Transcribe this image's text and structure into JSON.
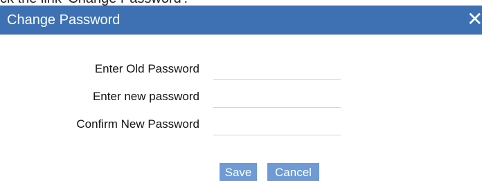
{
  "background_text": "ck the link 'Change Password'.",
  "dialog": {
    "title": "Change Password",
    "close_label": "✕",
    "header_color": "#3d71b3",
    "button_color": "#6e9ad6"
  },
  "form": {
    "fields": [
      {
        "label": "Enter Old Password",
        "value": "",
        "placeholder": ""
      },
      {
        "label": "Enter new password",
        "value": "",
        "placeholder": ""
      },
      {
        "label": "Confirm New Password",
        "value": "",
        "placeholder": ""
      }
    ]
  },
  "buttons": {
    "save_label": "Save",
    "cancel_label": "Cancel"
  }
}
